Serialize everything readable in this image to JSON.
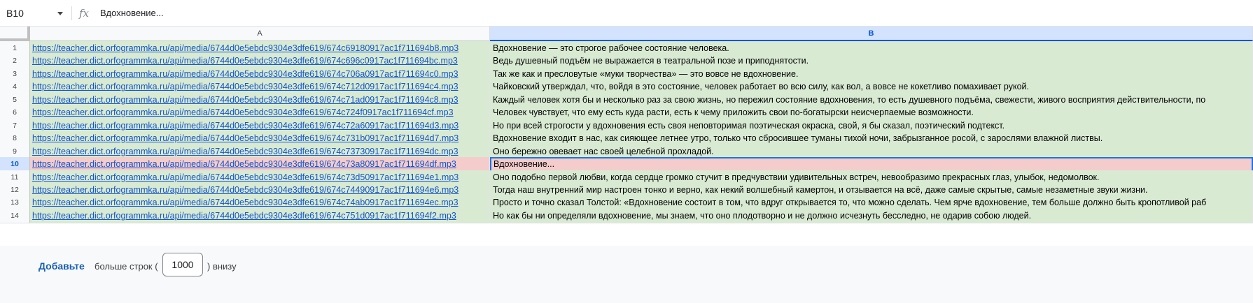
{
  "formula_bar": {
    "cell_ref": "B10",
    "fx_label": "fx",
    "content": "Вдохновение..."
  },
  "columns": [
    {
      "label": "A",
      "selected": false
    },
    {
      "label": "B",
      "selected": true
    }
  ],
  "rows": [
    {
      "num": "1",
      "a": "https://teacher.dict.orfogrammka.ru/api/media/6744d0e5ebdc9304e3dfe619/674c69180917ac1f711694b8.mp3",
      "b": "Вдохновение — это строгое рабочее состояние человека."
    },
    {
      "num": "2",
      "a": "https://teacher.dict.orfogrammka.ru/api/media/6744d0e5ebdc9304e3dfe619/674c696c0917ac1f711694bc.mp3",
      "b": "Ведь душевный подъём не выражается в театральной позе и приподнятости."
    },
    {
      "num": "3",
      "a": "https://teacher.dict.orfogrammka.ru/api/media/6744d0e5ebdc9304e3dfe619/674c706a0917ac1f711694c0.mp3",
      "b": "Так же как и пресловутые «муки творчества» — это вовсе не вдохновение."
    },
    {
      "num": "4",
      "a": "https://teacher.dict.orfogrammka.ru/api/media/6744d0e5ebdc9304e3dfe619/674c712d0917ac1f711694c4.mp3",
      "b": "Чайковский утверждал, что, войдя в это состояние, человек работает во всю силу, как вол, а вовсе не кокетливо помахивает рукой."
    },
    {
      "num": "5",
      "a": "https://teacher.dict.orfogrammka.ru/api/media/6744d0e5ebdc9304e3dfe619/674c71ad0917ac1f711694c8.mp3",
      "b": "Каждый человек хотя бы и несколько раз за свою жизнь, но пережил состояние вдохновения, то есть душевного подъёма, свежести, живого восприятия действительности, по"
    },
    {
      "num": "6",
      "a": "https://teacher.dict.orfogrammka.ru/api/media/6744d0e5ebdc9304e3dfe619/674c724f0917ac1f711694cf.mp3",
      "b": "Человек чувствует, что ему есть куда расти, есть к чему приложить свои по-богатырски неисчерпаемые возможности."
    },
    {
      "num": "7",
      "a": "https://teacher.dict.orfogrammka.ru/api/media/6744d0e5ebdc9304e3dfe619/674c72a60917ac1f711694d3.mp3",
      "b": "Но при всей строгости у вдохновения есть своя неповторимая поэтическая окраска, свой, я бы сказал, поэтический подтекст."
    },
    {
      "num": "8",
      "a": "https://teacher.dict.orfogrammka.ru/api/media/6744d0e5ebdc9304e3dfe619/674c731b0917ac1f711694d7.mp3",
      "b": "Вдохновение входит в нас, как сияющее летнее утро, только что сбросившее туманы тихой ночи, забрызганное росой, с зарослями влажной листвы."
    },
    {
      "num": "9",
      "a": "https://teacher.dict.orfogrammka.ru/api/media/6744d0e5ebdc9304e3dfe619/674c73730917ac1f711694dc.mp3",
      "b": "Оно бережно овевает нас своей целебной прохладой."
    },
    {
      "num": "10",
      "a": "https://teacher.dict.orfogrammka.ru/api/media/6744d0e5ebdc9304e3dfe619/674c73a80917ac1f711694df.mp3",
      "b": "Вдохновение...",
      "active": true
    },
    {
      "num": "11",
      "a": "https://teacher.dict.orfogrammka.ru/api/media/6744d0e5ebdc9304e3dfe619/674c73d50917ac1f711694e1.mp3",
      "b": "Оно подобно первой любви, когда сердце громко стучит в предчувствии удивительных встреч, невообразимо прекрасных глаз, улыбок, недомолвок."
    },
    {
      "num": "12",
      "a": "https://teacher.dict.orfogrammka.ru/api/media/6744d0e5ebdc9304e3dfe619/674c74490917ac1f711694e6.mp3",
      "b": "Тогда наш внутренний мир настроен тонко и верно, как некий волшебный камертон, и отзывается на всё, даже самые скрытые, самые незаметные звуки жизни."
    },
    {
      "num": "13",
      "a": "https://teacher.dict.orfogrammka.ru/api/media/6744d0e5ebdc9304e3dfe619/674c74ab0917ac1f711694ec.mp3",
      "b": "Просто и точно сказал Толстой: «Вдохновение состоит в том, что вдруг открывается то, что можно сделать. Чем ярче вдохновение, тем больше должно быть кропотливой раб"
    },
    {
      "num": "14",
      "a": "https://teacher.dict.orfogrammka.ru/api/media/6744d0e5ebdc9304e3dfe619/674c751d0917ac1f711694f2.mp3",
      "b": "Но как бы ни определяли вдохновение, мы знаем, что оно плодотворно и не должно исчезнуть бесследно, не одарив собою людей."
    }
  ],
  "add_rows": {
    "button_label": "Добавьте",
    "text_before": "больше строк (",
    "count": "1000",
    "text_after": ") внизу"
  },
  "colors": {
    "row_fill": "#d9ead3",
    "active_row_fill": "#f4cccc",
    "link": "#1155cc",
    "selection": "#1a73e8"
  }
}
